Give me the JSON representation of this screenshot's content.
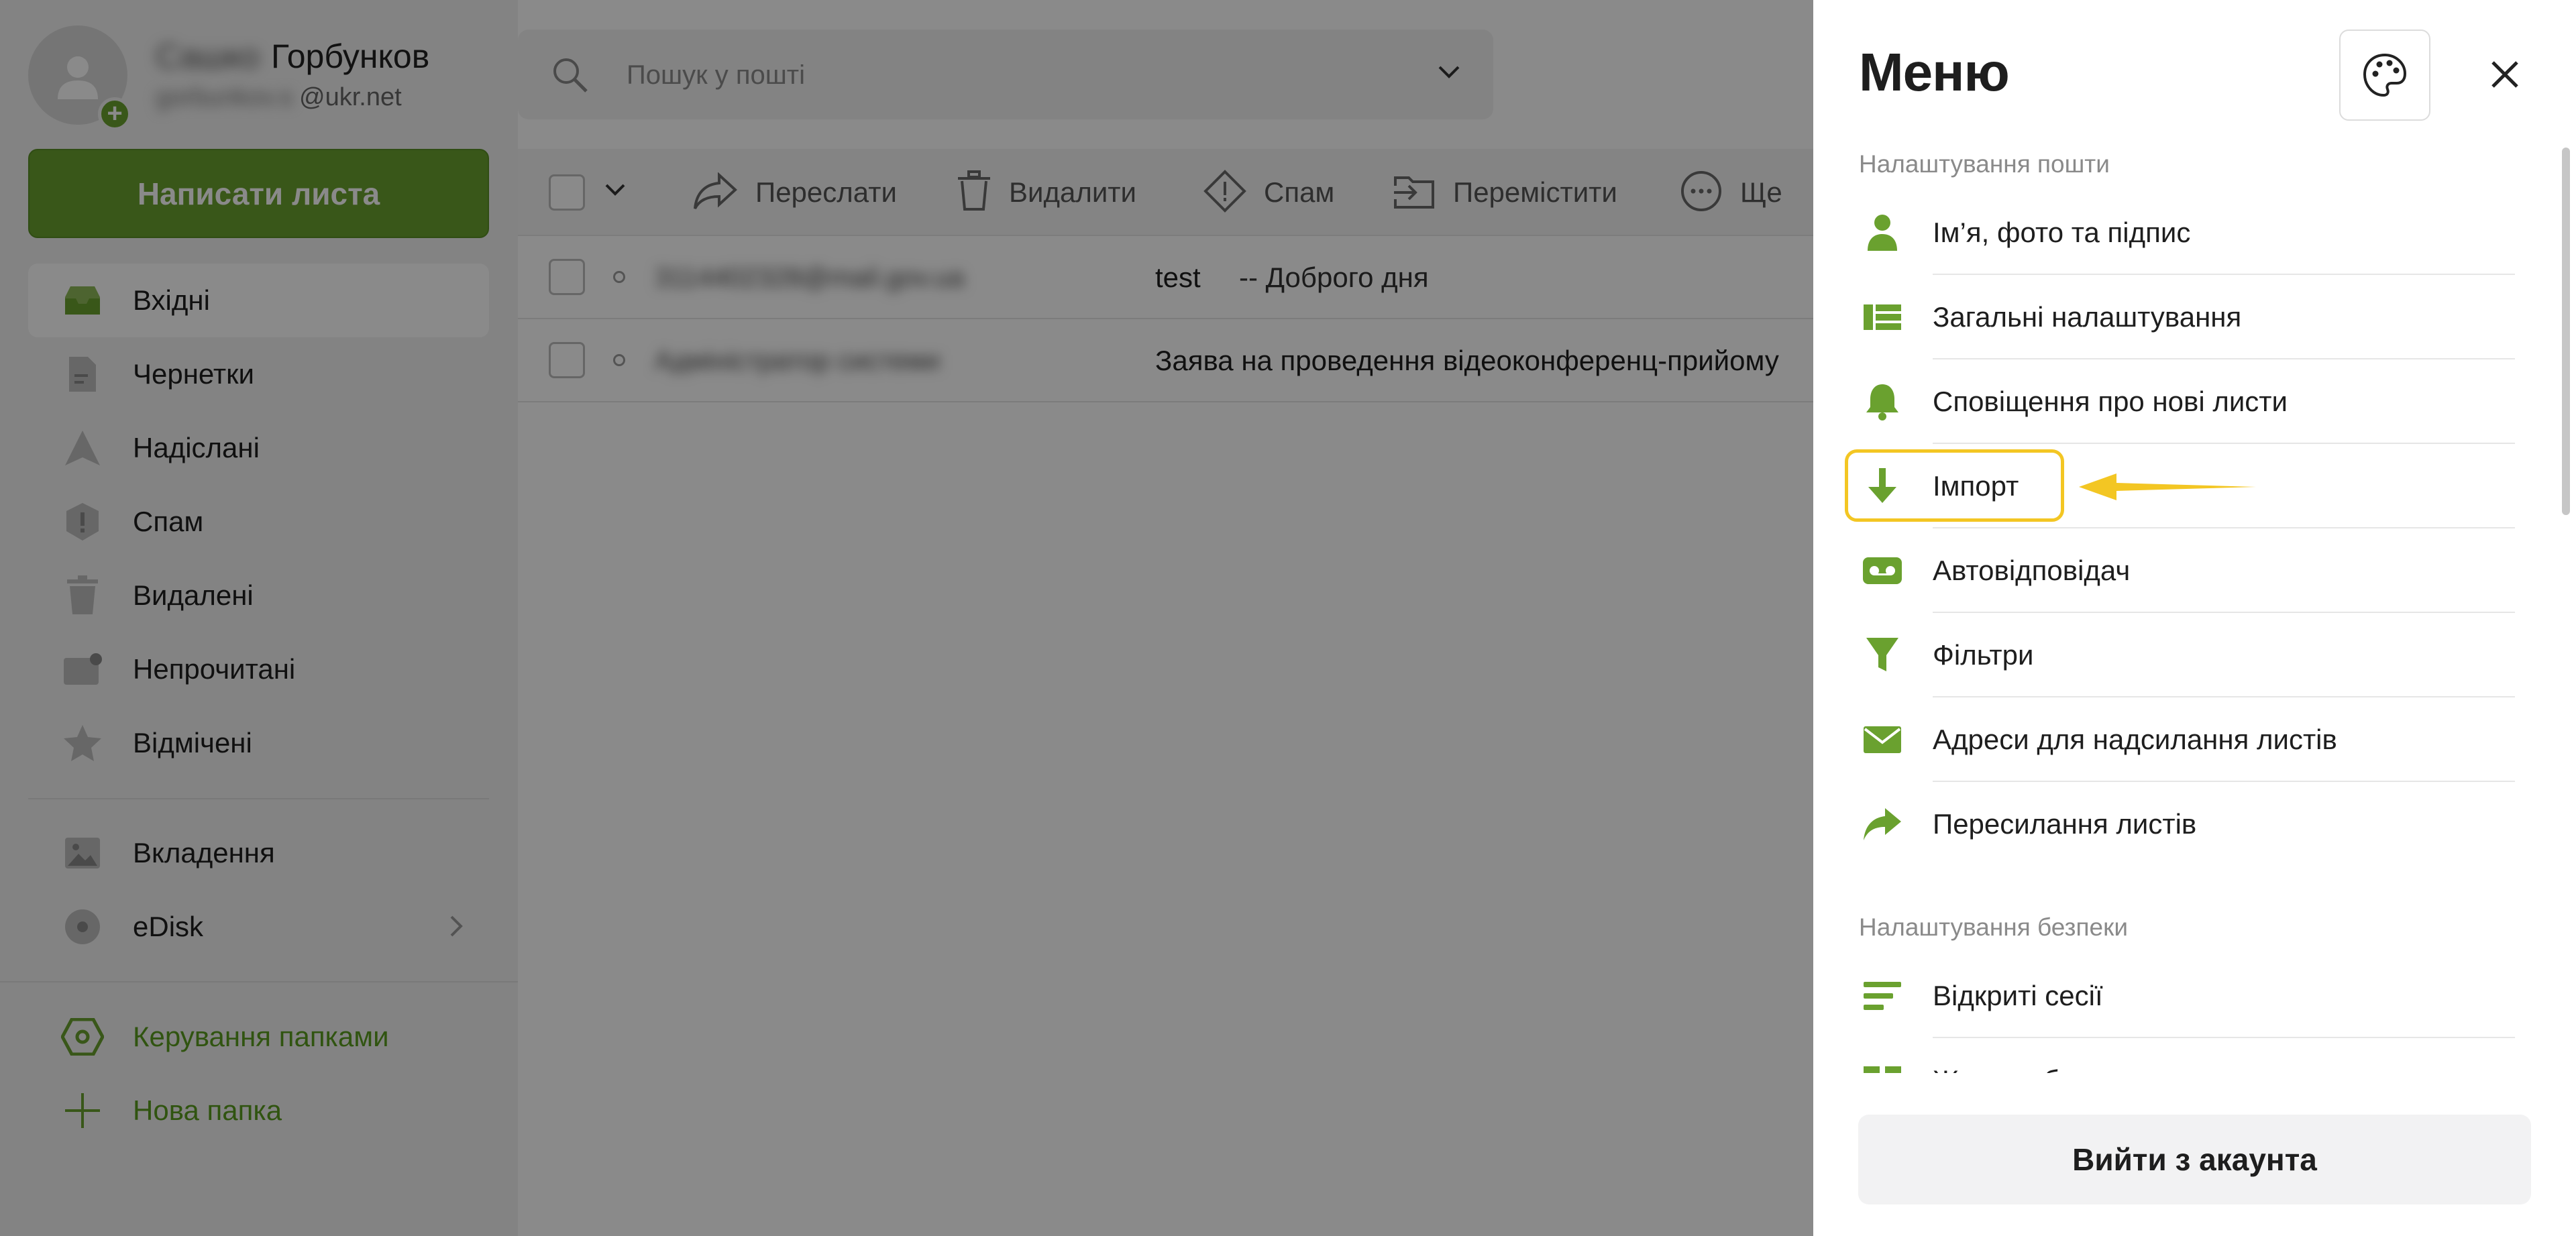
{
  "user": {
    "first_name": "Сашко",
    "last_name": "Горбунков",
    "mail_blurred": "gorbunkov.s",
    "mail_domain": "@ukr.net"
  },
  "sidebar": {
    "compose_label": "Написати листа",
    "folders": [
      {
        "label": "Вхідні",
        "icon": "inbox-icon"
      },
      {
        "label": "Чернетки",
        "icon": "draft-icon"
      },
      {
        "label": "Надіслані",
        "icon": "sent-icon"
      },
      {
        "label": "Спам",
        "icon": "spam-icon"
      },
      {
        "label": "Видалені",
        "icon": "trash-icon"
      },
      {
        "label": "Непрочитані",
        "icon": "unread-icon"
      },
      {
        "label": "Відмічені",
        "icon": "star-icon"
      }
    ],
    "extra": [
      {
        "label": "Вкладення",
        "icon": "image-icon"
      },
      {
        "label": "eDisk",
        "icon": "disk-icon"
      }
    ],
    "actions": [
      {
        "label": "Керування папками",
        "icon": "folder-settings-icon"
      },
      {
        "label": "Нова папка",
        "icon": "plus-icon"
      }
    ]
  },
  "search": {
    "placeholder": "Пошук у пошті"
  },
  "toolbar": {
    "forward_label": "Переслати",
    "delete_label": "Видалити",
    "spam_label": "Спам",
    "move_label": "Перемістити",
    "more_label": "Ще"
  },
  "messages": [
    {
      "sender": "3114402328@mail.gov.ua",
      "subject": "test",
      "preview": "-- Доброго дня"
    },
    {
      "sender": "Адміністратор системи",
      "subject": "Заява на проведення відеоконференц-прийому",
      "preview": ""
    }
  ],
  "menu": {
    "title": "Меню",
    "mail_section_title": "Налаштування пошти",
    "mail_items": [
      {
        "label": "Ім’я, фото та підпис",
        "icon": "person-icon"
      },
      {
        "label": "Загальні налаштування",
        "icon": "list-icon"
      },
      {
        "label": "Сповіщення про нові листи",
        "icon": "bell-icon"
      },
      {
        "label": "Імпорт",
        "icon": "download-arrow-icon"
      },
      {
        "label": "Автовідповідач",
        "icon": "voicemail-icon"
      },
      {
        "label": "Фільтри",
        "icon": "filter-icon"
      },
      {
        "label": "Адреси для надсилання листів",
        "icon": "envelope-icon"
      },
      {
        "label": "Пересилання листів",
        "icon": "forward-icon"
      }
    ],
    "security_section_title": "Налаштування безпеки",
    "security_items": [
      {
        "label": "Відкриті сесії",
        "icon": "sessions-icon"
      },
      {
        "label": "Журнал безпеки",
        "icon": "journal-icon"
      }
    ],
    "logout_label": "Вийти з акаунта"
  },
  "colors": {
    "accent": "#6aa12f",
    "highlight": "#f3c623",
    "overlay": "#000000"
  }
}
